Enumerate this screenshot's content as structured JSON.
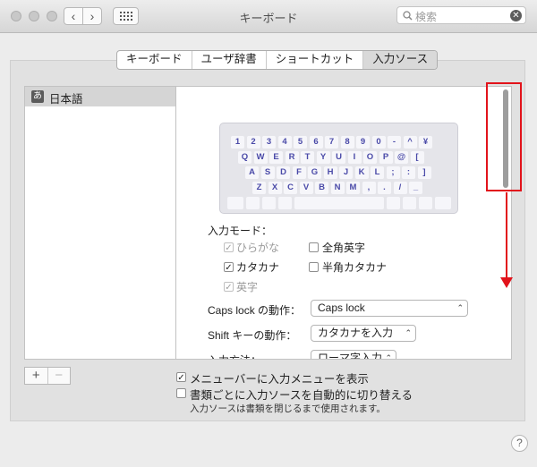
{
  "window": {
    "title": "キーボード"
  },
  "search": {
    "placeholder": "検索"
  },
  "tabs": [
    {
      "label": "キーボード"
    },
    {
      "label": "ユーザ辞書"
    },
    {
      "label": "ショートカット"
    },
    {
      "label": "入力ソース"
    }
  ],
  "sources": [
    {
      "icon_text": "あ",
      "label": "日本語"
    }
  ],
  "keyboard": {
    "rows": [
      [
        "1",
        "2",
        "3",
        "4",
        "5",
        "6",
        "7",
        "8",
        "9",
        "0",
        "-",
        "^",
        "¥"
      ],
      [
        "Q",
        "W",
        "E",
        "R",
        "T",
        "Y",
        "U",
        "I",
        "O",
        "P",
        "@",
        "["
      ],
      [
        "A",
        "S",
        "D",
        "F",
        "G",
        "H",
        "J",
        "K",
        "L",
        ";",
        ":",
        "]"
      ],
      [
        "Z",
        "X",
        "C",
        "V",
        "B",
        "N",
        "M",
        ",",
        ".",
        "/",
        "_"
      ]
    ]
  },
  "input_modes": {
    "heading": "入力モード：",
    "hiragana": "ひらがな",
    "zenkaku_eiji": "全角英字",
    "katakana": "カタカナ",
    "hankaku_katakana": "半角カタカナ",
    "eiji": "英字"
  },
  "caps_lock": {
    "label": "Caps lock の動作：",
    "value": "Caps lock"
  },
  "shift": {
    "label": "Shift キーの動作：",
    "value": "カタカナを入力"
  },
  "input_method": {
    "label": "入力方法：",
    "value": "ローマ字入力"
  },
  "controls": {
    "plus": "+",
    "minus": "−",
    "help": "?"
  },
  "options": {
    "show_menu": "メニューバーに入力メニューを表示",
    "auto_switch": "書類ごとに入力ソースを自動的に切り替える",
    "note": "入力ソースは書類を閉じるまで使用されます。"
  }
}
